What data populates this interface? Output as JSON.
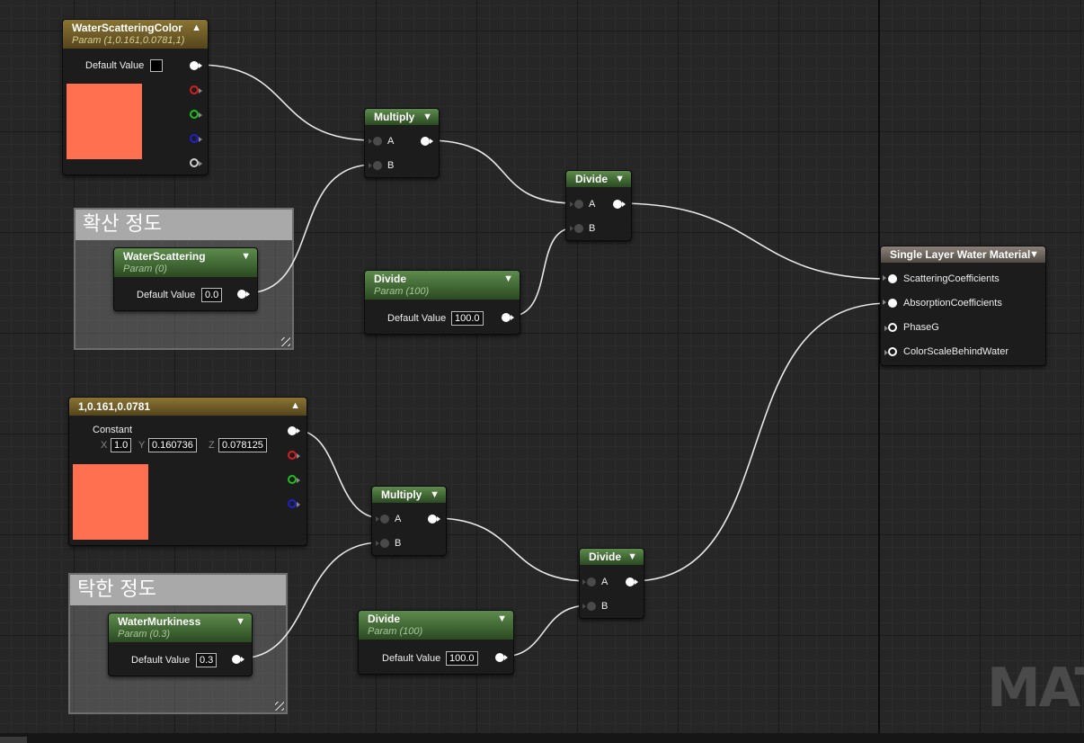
{
  "colors": {
    "scattering_swatch": "#ff7050",
    "constant_swatch": "#ff7050",
    "param_header": "#5d8b4c",
    "vector_header": "#8a7433"
  },
  "watermark": "MAT",
  "comments": {
    "scattering": "확산 정도",
    "murkiness": "탁한 정도"
  },
  "nodes": {
    "water_scattering_color": {
      "title": "WaterScatteringColor",
      "subtitle": "Param (1,0.161,0.0781,1)",
      "default_label": "Default Value",
      "collapse_icon": "chevron-up-icon"
    },
    "water_scattering": {
      "title": "WaterScattering",
      "subtitle": "Param (0)",
      "default_label": "Default Value",
      "default_value": "0.0"
    },
    "multiply_1": {
      "title": "Multiply",
      "pin_a": "A",
      "pin_b": "B"
    },
    "divide_1": {
      "title": "Divide",
      "pin_a": "A",
      "pin_b": "B"
    },
    "divide_param_1": {
      "title": "Divide",
      "subtitle": "Param (100)",
      "default_label": "Default Value",
      "default_value": "100.0"
    },
    "material": {
      "title": "Single Layer Water Material",
      "pins": [
        "ScatteringCoefficients",
        "AbsorptionCoefficients",
        "PhaseG",
        "ColorScaleBehindWater"
      ]
    },
    "constant": {
      "title": "1,0.161,0.0781",
      "label": "Constant",
      "x_label": "X",
      "x": "1.0",
      "y_label": "Y",
      "y": "0.160736",
      "z_label": "Z",
      "z": "0.078125"
    },
    "multiply_2": {
      "title": "Multiply",
      "pin_a": "A",
      "pin_b": "B"
    },
    "divide_2": {
      "title": "Divide",
      "pin_a": "A",
      "pin_b": "B"
    },
    "divide_param_2": {
      "title": "Divide",
      "subtitle": "Param (100)",
      "default_label": "Default Value",
      "default_value": "100.0"
    },
    "water_murkiness": {
      "title": "WaterMurkiness",
      "subtitle": "Param (0.3)",
      "default_label": "Default Value",
      "default_value": "0.3"
    }
  }
}
